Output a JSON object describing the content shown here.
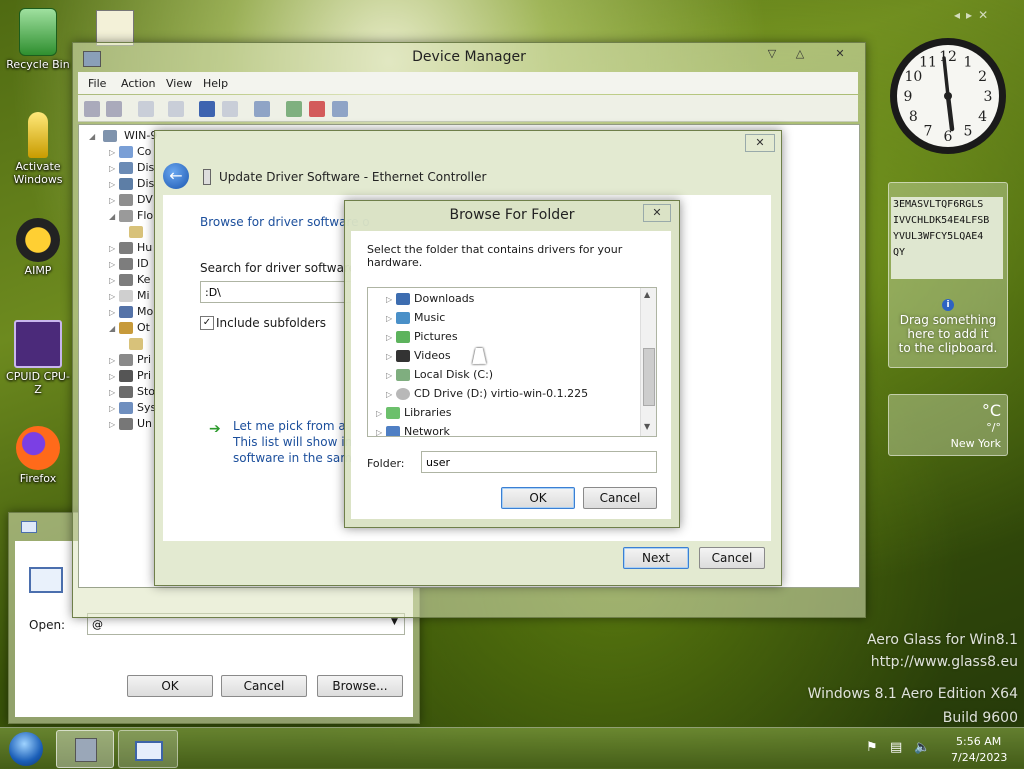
{
  "desktop": {
    "icons": [
      {
        "label": "Recycle Bin",
        "icon": "recycle-bin-icon"
      },
      {
        "label": "Activate\nWindows",
        "icon": "key-icon"
      },
      {
        "label": "AIMP",
        "icon": "aimp-icon"
      },
      {
        "label": "CPUID CPU-Z",
        "icon": "cpuz-icon"
      },
      {
        "label": "Firefox",
        "icon": "firefox-icon"
      }
    ],
    "watermark": {
      "line1": "Aero Glass for Win8.1",
      "line2": "http://www.glass8.eu",
      "line3": "Windows 8.1 Aero Edition X64",
      "line4": "Build 9600"
    }
  },
  "device_manager": {
    "title": "Device Manager",
    "menu": [
      "File",
      "Action",
      "View",
      "Help"
    ],
    "root": "WIN-9",
    "tree": [
      "Co",
      "Dis",
      "Dis",
      "DV",
      "Flo",
      "",
      "Hu",
      "ID",
      "Ke",
      "Mi",
      "Mo",
      "Ot",
      "",
      "Pri",
      "Pri",
      "Sto",
      "Sys",
      "Un"
    ]
  },
  "update_driver": {
    "title": "Update Driver Software - Ethernet Controller",
    "heading": "Browse for driver software o",
    "search_label": "Search for driver software in",
    "path_value": ":D\\",
    "include_subfolders": "Include subfolders",
    "pick_line1": "Let me pick from a lis",
    "pick_line2": "This list will show inst",
    "pick_line3": "software in the same",
    "next": "Next",
    "cancel": "Cancel"
  },
  "browse_folder": {
    "title": "Browse For Folder",
    "instruction": "Select the folder that contains drivers for your hardware.",
    "items": [
      {
        "label": "Downloads",
        "icon": "downloads-icon",
        "indent": 2
      },
      {
        "label": "Music",
        "icon": "music-icon",
        "indent": 2
      },
      {
        "label": "Pictures",
        "icon": "pictures-icon",
        "indent": 2
      },
      {
        "label": "Videos",
        "icon": "videos-icon",
        "indent": 2
      },
      {
        "label": "Local Disk (C:)",
        "icon": "local-disk-icon",
        "indent": 2
      },
      {
        "label": "CD Drive (D:) virtio-win-0.1.225",
        "icon": "cd-drive-icon",
        "indent": 2
      },
      {
        "label": "Libraries",
        "icon": "libraries-icon",
        "indent": 1
      },
      {
        "label": "Network",
        "icon": "network-icon",
        "indent": 1
      }
    ],
    "folder_label": "Folder:",
    "folder_value": "user",
    "ok": "OK",
    "cancel": "Cancel"
  },
  "run_dialog": {
    "open_label": "Open:",
    "open_value": "@",
    "ok": "OK",
    "cancel": "Cancel",
    "browse": "Browse..."
  },
  "gadgets": {
    "clipboard_text": "3EMASVLTQF6RGLS\nIVVCHLDK54E4LFSB\nYVUL3WFCY5LQAE4\nQY",
    "clipboard_hint": "Drag something\nhere to add it\nto the clipboard.",
    "weather_unit": "°C",
    "weather_temp": "°/°",
    "weather_city": "New York",
    "clock_numbers": [
      "12",
      "1",
      "2",
      "3",
      "4",
      "5",
      "6",
      "7",
      "8",
      "9",
      "10",
      "11"
    ]
  },
  "taskbar": {
    "time": "5:56 AM",
    "date": "7/24/2023"
  },
  "colors": {
    "accent_blue": "#1e5fb4",
    "link_blue": "#1c4f9c"
  }
}
